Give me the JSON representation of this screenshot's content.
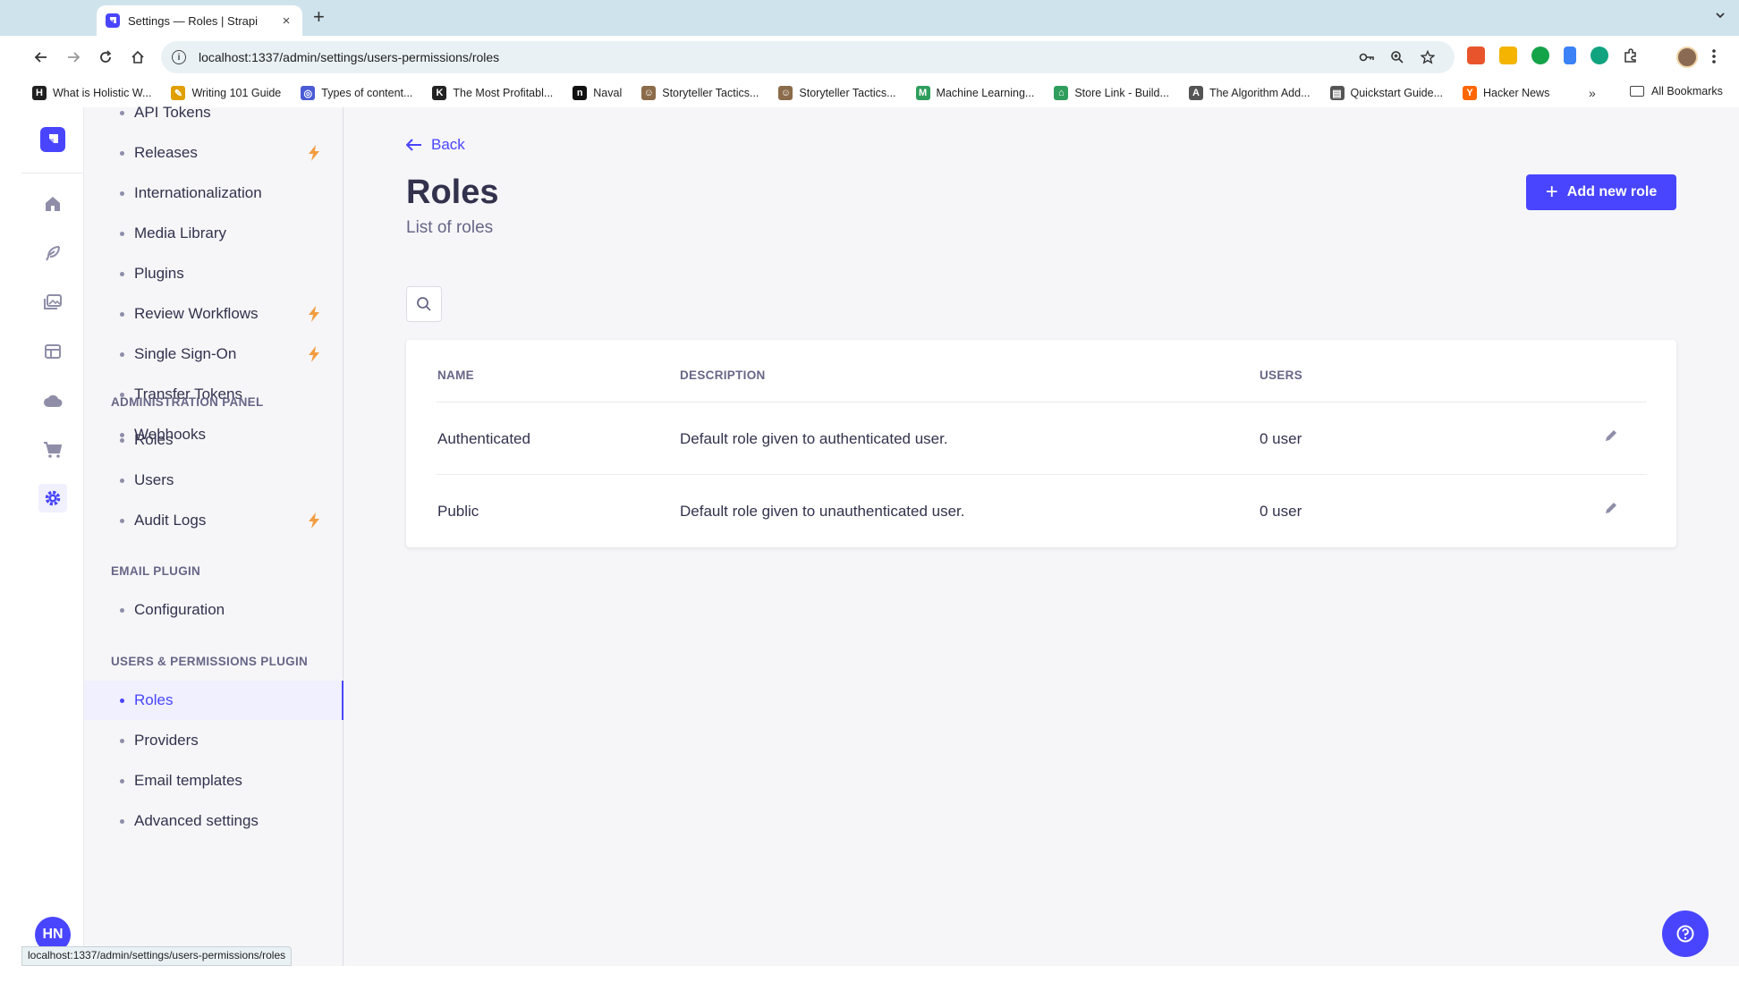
{
  "browser": {
    "tab_title": "Settings — Roles | Strapi",
    "tab_close": "×",
    "new_tab": "+",
    "url": "localhost:1337/admin/settings/users-permissions/roles",
    "bookmarks": [
      {
        "label": "What is Holistic W...",
        "icon": "H",
        "color": "#1f1f1f"
      },
      {
        "label": "Writing 101 Guide",
        "icon": "✎",
        "color": "#e0a000"
      },
      {
        "label": "Types of content...",
        "icon": "◎",
        "color": "#4a5bd4"
      },
      {
        "label": "The Most Profitabl...",
        "icon": "K",
        "color": "#222222"
      },
      {
        "label": "Naval",
        "icon": "n",
        "color": "#111111"
      },
      {
        "label": "Storyteller Tactics...",
        "icon": "☺",
        "color": "#8b6b4a"
      },
      {
        "label": "Storyteller Tactics...",
        "icon": "☺",
        "color": "#8b6b4a"
      },
      {
        "label": "Machine Learning...",
        "icon": "M",
        "color": "#2f9e5c"
      },
      {
        "label": "Store Link - Build...",
        "icon": "⌂",
        "color": "#2f9e5c"
      },
      {
        "label": "The Algorithm Add...",
        "icon": "A",
        "color": "#555555"
      },
      {
        "label": "Quickstart Guide...",
        "icon": "▤",
        "color": "#555555"
      },
      {
        "label": "Hacker News",
        "icon": "Y",
        "color": "#ff6600"
      }
    ],
    "bookmarks_more": "»",
    "all_bookmarks": "All Bookmarks",
    "status_url": "localhost:1337/admin/settings/users-permissions/roles"
  },
  "sidebar": {
    "items_top": [
      {
        "label": "API Tokens",
        "bolt": false
      },
      {
        "label": "Releases",
        "bolt": true
      },
      {
        "label": "Internationalization",
        "bolt": false
      },
      {
        "label": "Media Library",
        "bolt": false
      },
      {
        "label": "Plugins",
        "bolt": false
      },
      {
        "label": "Review Workflows",
        "bolt": true
      },
      {
        "label": "Single Sign-On",
        "bolt": true
      },
      {
        "label": "Transfer Tokens",
        "bolt": false
      },
      {
        "label": "Webhooks",
        "bolt": false
      }
    ],
    "section_admin": "ADMINISTRATION PANEL",
    "items_admin": [
      {
        "label": "Roles",
        "bolt": false
      },
      {
        "label": "Users",
        "bolt": false
      },
      {
        "label": "Audit Logs",
        "bolt": true
      }
    ],
    "section_email": "EMAIL PLUGIN",
    "items_email": [
      {
        "label": "Configuration",
        "bolt": false
      }
    ],
    "section_users": "USERS & PERMISSIONS PLUGIN",
    "items_users": [
      {
        "label": "Roles",
        "bolt": false,
        "active": true
      },
      {
        "label": "Providers",
        "bolt": false
      },
      {
        "label": "Email templates",
        "bolt": false
      },
      {
        "label": "Advanced settings",
        "bolt": false
      }
    ]
  },
  "user": {
    "initials": "HN"
  },
  "main": {
    "back_label": "Back",
    "title": "Roles",
    "subtitle": "List of roles",
    "add_button": "Add new role",
    "table": {
      "headers": {
        "name": "NAME",
        "description": "DESCRIPTION",
        "users": "USERS"
      },
      "rows": [
        {
          "name": "Authenticated",
          "description": "Default role given to authenticated user.",
          "users": "0 user"
        },
        {
          "name": "Public",
          "description": "Default role given to unauthenticated user.",
          "users": "0 user"
        }
      ]
    }
  },
  "colors": {
    "primary": "#4945ff",
    "bolt": "#f29d41",
    "nav_bg": "#f6f6f9"
  }
}
